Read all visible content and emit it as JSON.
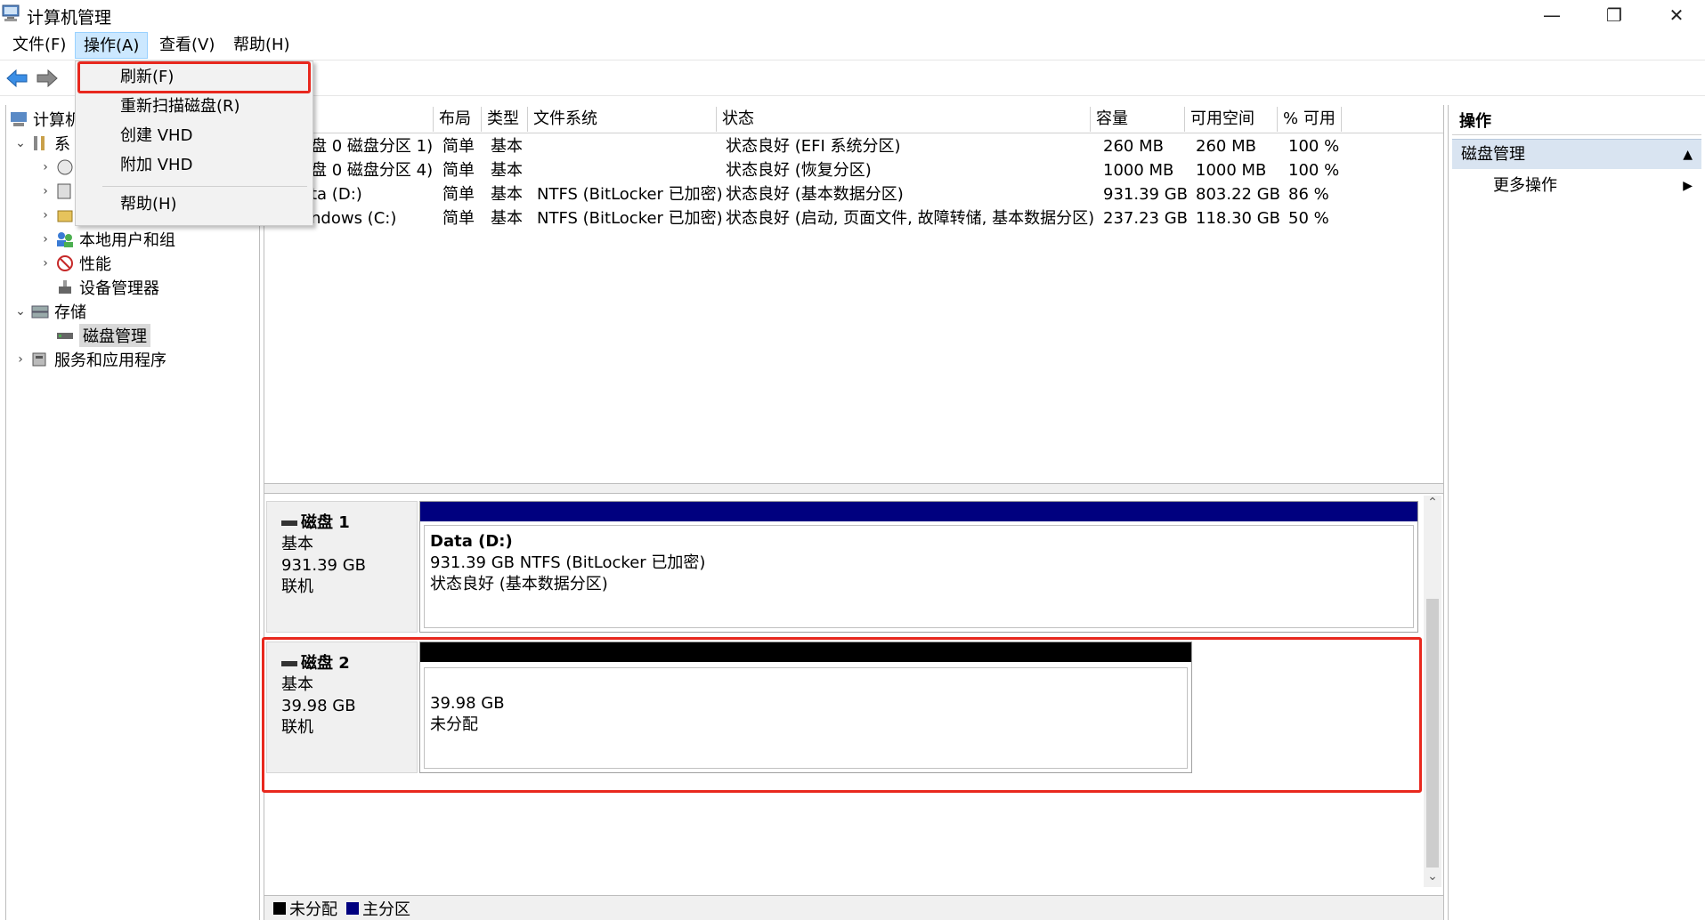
{
  "window": {
    "title": "计算机管理",
    "minimize": "—",
    "maximize": "❐",
    "close": "✕"
  },
  "menubar": [
    {
      "label": "文件(F)"
    },
    {
      "label": "操作(A)"
    },
    {
      "label": "查看(V)"
    },
    {
      "label": "帮助(H)"
    }
  ],
  "dropdown": {
    "items": [
      "刷新(F)",
      "重新扫描磁盘(R)",
      "创建 VHD",
      "附加 VHD",
      "帮助(H)"
    ]
  },
  "tree": {
    "root": "计算机",
    "system_tools": "系",
    "local_users": "本地用户和组",
    "performance": "性能",
    "device_manager": "设备管理器",
    "storage": "存储",
    "disk_mgmt": "磁盘管理",
    "services": "服务和应用程序"
  },
  "table": {
    "headers": [
      "布局",
      "类型",
      "文件系统",
      "状态",
      "容量",
      "可用空间",
      "% 可用"
    ],
    "rows": [
      {
        "vol": "盘 0 磁盘分区 1)",
        "layout": "简单",
        "type": "基本",
        "fs": "",
        "status": "状态良好 (EFI 系统分区)",
        "cap": "260 MB",
        "free": "260 MB",
        "pct": "100 %"
      },
      {
        "vol": "盘 0 磁盘分区 4)",
        "layout": "简单",
        "type": "基本",
        "fs": "",
        "status": "状态良好 (恢复分区)",
        "cap": "1000 MB",
        "free": "1000 MB",
        "pct": "100 %"
      },
      {
        "vol": "ta (D:)",
        "layout": "简单",
        "type": "基本",
        "fs": "NTFS (BitLocker 已加密)",
        "status": "状态良好 (基本数据分区)",
        "cap": "931.39 GB",
        "free": "803.22 GB",
        "pct": "86 %"
      },
      {
        "vol": "ndows (C:)",
        "layout": "简单",
        "type": "基本",
        "fs": "NTFS (BitLocker 已加密)",
        "status": "状态良好 (启动, 页面文件, 故障转储, 基本数据分区)",
        "cap": "237.23 GB",
        "free": "118.30 GB",
        "pct": "50 %"
      }
    ]
  },
  "disks": [
    {
      "name": "磁盘 1",
      "type": "基本",
      "size": "931.39 GB",
      "state": "联机",
      "part_title": "Data  (D:)",
      "part_line1": "931.39 GB NTFS (BitLocker 已加密)",
      "part_line2": "状态良好 (基本数据分区)"
    },
    {
      "name": "磁盘 2",
      "type": "基本",
      "size": "39.98 GB",
      "state": "联机",
      "part_title": "",
      "part_line1": "39.98 GB",
      "part_line2": "未分配"
    }
  ],
  "legend": {
    "unallocated": "未分配",
    "primary": "主分区"
  },
  "actions": {
    "header": "操作",
    "section": "磁盘管理",
    "more": "更多操作"
  },
  "colors": {
    "primary_partition": "#00007f",
    "unallocated": "#000000",
    "highlight_red": "#e8281e"
  }
}
